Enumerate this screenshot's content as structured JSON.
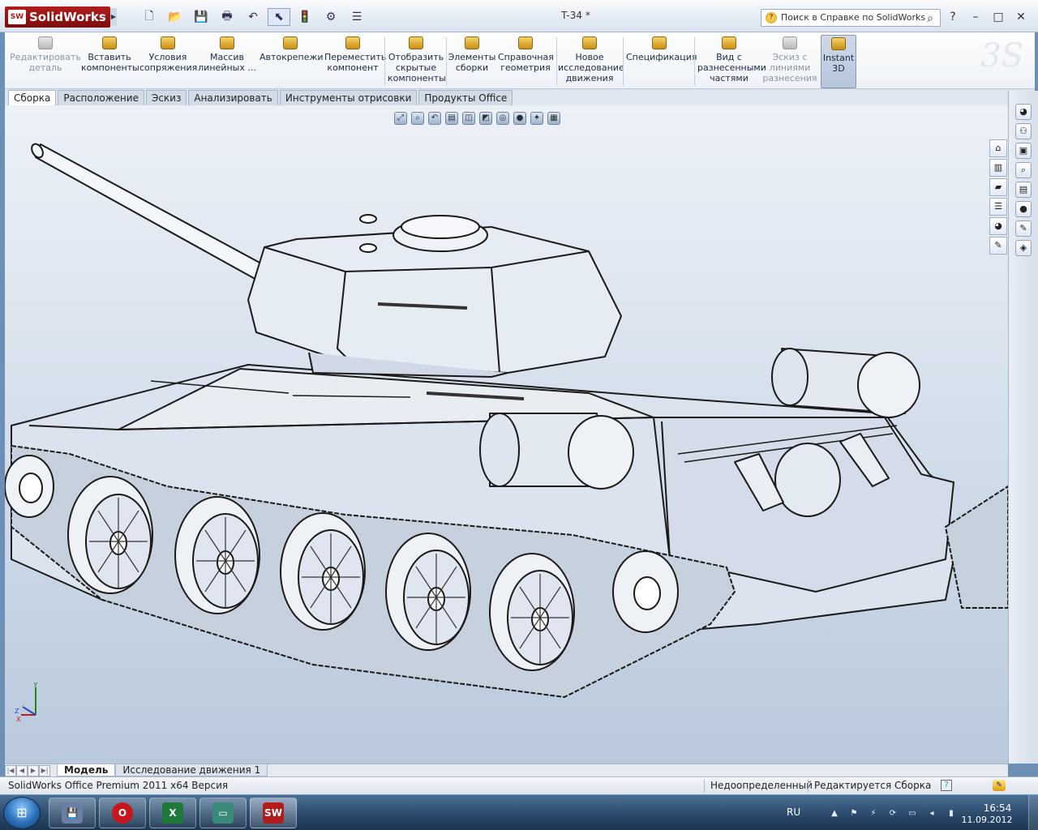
{
  "app": {
    "logo_text": "SolidWorks",
    "logo_badge": "SW",
    "document_title": "T-34 *"
  },
  "help_search": {
    "placeholder": "Поиск в Справке по SolidWorks",
    "icon": "help-icon",
    "search_icon": "magnifier-icon"
  },
  "window_buttons": [
    "?",
    "–",
    "□",
    "✕"
  ],
  "quick_access": [
    {
      "name": "new-doc",
      "glyph": "🗋"
    },
    {
      "name": "open",
      "glyph": "📂"
    },
    {
      "name": "save",
      "glyph": "💾"
    },
    {
      "name": "print",
      "glyph": "🖶"
    },
    {
      "name": "undo",
      "glyph": "↶"
    },
    {
      "name": "select",
      "glyph": "⬉"
    },
    {
      "name": "rebuild",
      "glyph": "🚦"
    },
    {
      "name": "options",
      "glyph": "⚙"
    },
    {
      "name": "file-props",
      "glyph": "☰"
    }
  ],
  "ribbon": {
    "buttons": [
      {
        "label": "Редактировать деталь",
        "disabled": true
      },
      {
        "label": "Вставить компоненты",
        "disabled": false
      },
      {
        "label": "Условия сопряжения",
        "disabled": false
      },
      {
        "label": "Массив линейных ...",
        "disabled": false
      },
      {
        "label": "Автокрепежи",
        "disabled": false
      },
      {
        "label": "Переместить компонент",
        "disabled": false
      },
      {
        "label": "Отобразить скрытые компоненты",
        "disabled": false
      },
      {
        "label": "Элементы сборки",
        "disabled": false
      },
      {
        "label": "Справочная геометрия",
        "disabled": false
      },
      {
        "label": "Новое исследование движения",
        "disabled": false
      },
      {
        "label": "Спецификация",
        "disabled": false
      },
      {
        "label": "Вид с разнесенными частями",
        "disabled": false
      },
      {
        "label": "Эскиз с линиями разнесения",
        "disabled": true
      },
      {
        "label": "Instant 3D",
        "disabled": false,
        "selected": true
      }
    ]
  },
  "command_tabs": [
    "Сборка",
    "Расположение",
    "Эскиз",
    "Анализировать",
    "Инструменты отрисовки",
    "Продукты Office"
  ],
  "active_tab": "Сборка",
  "heads_up_toolbar": [
    "zoom-to-fit-icon",
    "zoom-area-icon",
    "previous-view-icon",
    "section-view-icon",
    "view-orientation-icon",
    "display-style-icon",
    "hide-show-icon",
    "appearance-icon",
    "scene-icon",
    "view-settings-icon"
  ],
  "model_tabs": [
    "Модель",
    "Исследование движения 1"
  ],
  "status_bar": {
    "product": "SolidWorks Office Premium 2011 x64 Версия",
    "definition": "Недоопределенный",
    "editing": "Редактируется Сборка"
  },
  "taskbar": {
    "apps": [
      {
        "name": "save-app",
        "label": "💾",
        "color": "#6a7fa6"
      },
      {
        "name": "opera",
        "label": "O",
        "color": "#c8161d"
      },
      {
        "name": "excel",
        "label": "X",
        "color": "#1e7a3a"
      },
      {
        "name": "window-app",
        "label": "▭",
        "color": "#3a8a7a"
      },
      {
        "name": "solidworks",
        "label": "SW",
        "color": "#b21c1c"
      }
    ],
    "language": "RU",
    "time": "16:54",
    "date": "11.09.2012"
  },
  "colors": {
    "accent": "#b21c1c",
    "viewport_top": "#ecf1f7",
    "viewport_bottom": "#b9c9dc"
  }
}
